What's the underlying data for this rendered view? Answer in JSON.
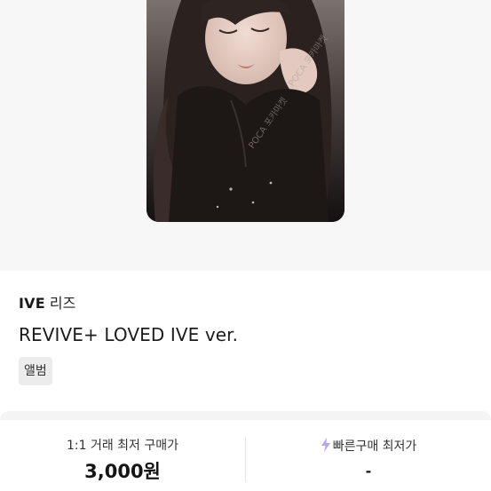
{
  "product": {
    "artist": "IVE",
    "member": "리즈",
    "title": "REVIVE+ LOVED IVE ver.",
    "category_tag": "앨범",
    "image_watermark": "POCA 포카마켓"
  },
  "pricing": {
    "direct_trade_label": "1:1 거래 최저 구매가",
    "direct_trade_price": "3,000원",
    "quick_buy_label": "빠른구매 최저가",
    "quick_buy_price": "-",
    "quick_buy_icon": "lightning-bolt-icon"
  },
  "colors": {
    "hero_background": "#f7f7f7",
    "tag_background": "#ececec",
    "bolt_accent": "#b7a6ef"
  }
}
